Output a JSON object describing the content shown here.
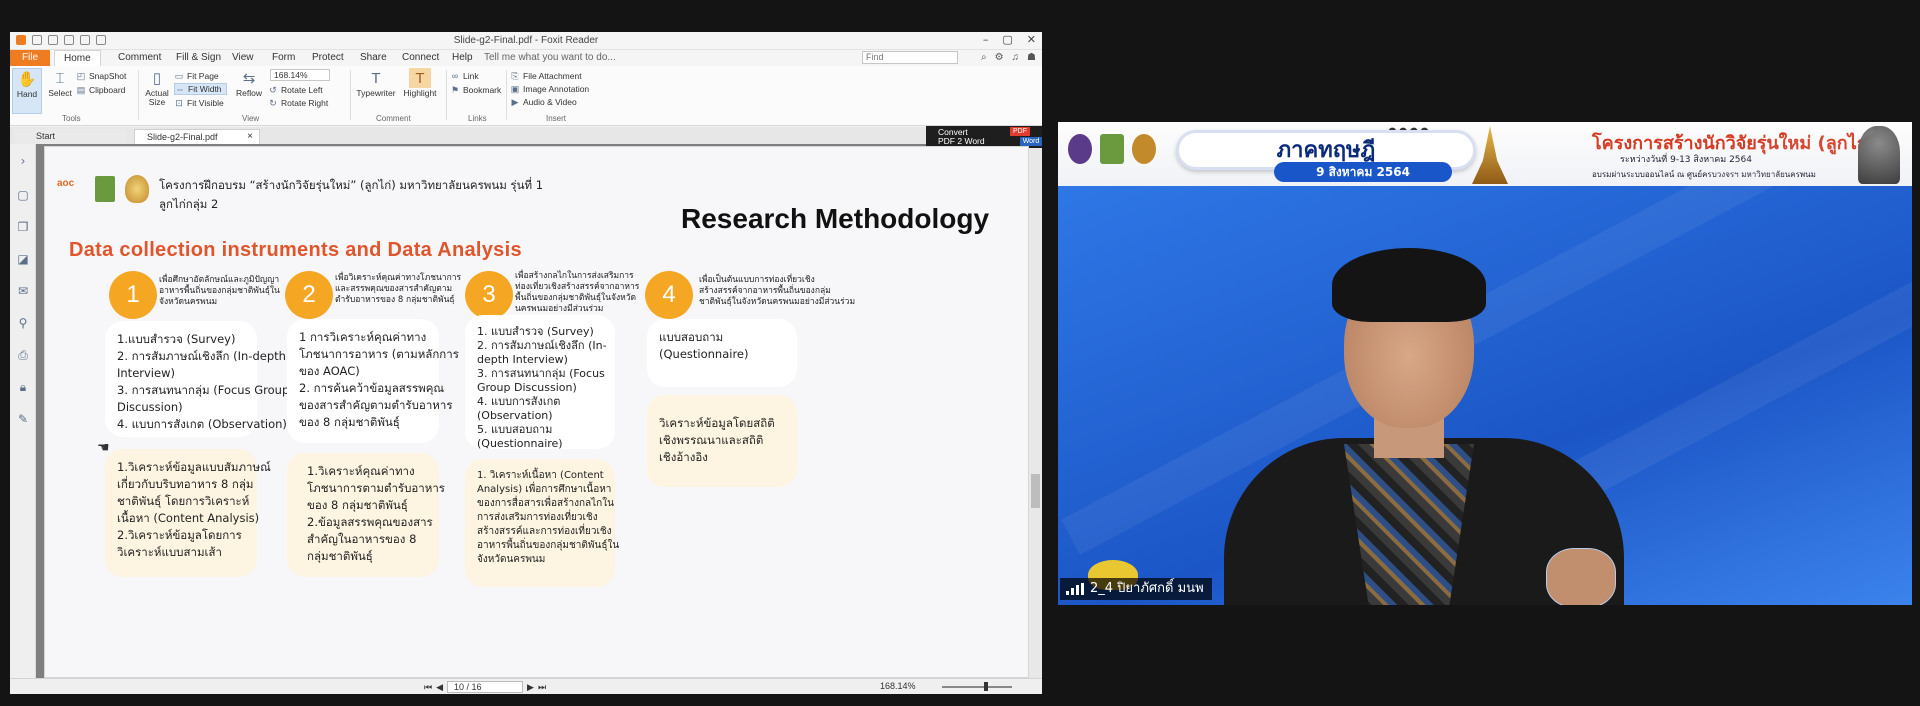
{
  "window": {
    "title": "Slide-g2-Final.pdf - Foxit Reader"
  },
  "menu": {
    "file": "File",
    "tabs": [
      "Home",
      "Comment",
      "Fill & Sign",
      "View",
      "Form",
      "Protect",
      "Share",
      "Connect",
      "Help"
    ],
    "tell_me": "Tell me what you want to do...",
    "find_placeholder": "Find"
  },
  "ribbon": {
    "hand": "Hand",
    "select": "Select",
    "snapshot": "SnapShot",
    "clipboard": "Clipboard",
    "actual_size": "Actual Size",
    "fit_page": "Fit Page",
    "fit_width": "Fit Width",
    "fit_visible": "Fit Visible",
    "reflow": "Reflow",
    "zoom": "168.14%",
    "rotate_left": "Rotate Left",
    "rotate_right": "Rotate Right",
    "typewriter": "Typewriter",
    "highlight": "Highlight",
    "link": "Link",
    "bookmark": "Bookmark",
    "file_attachment": "File Attachment",
    "image_annotation": "Image Annotation",
    "audio_video": "Audio & Video",
    "groups": {
      "tools": "Tools",
      "view": "View",
      "comment": "Comment",
      "links": "Links",
      "insert": "Insert"
    }
  },
  "doc_tabs": {
    "start": "Start",
    "file": "Slide-g2-Final.pdf",
    "close": "×"
  },
  "convert": {
    "line1": "Convert",
    "line2": "PDF 2 Word",
    "pdf": "PDF",
    "word": "Word"
  },
  "status": {
    "page": "10 / 16",
    "zoom": "168.14%"
  },
  "slide": {
    "aoc_logo": "aoc",
    "program": "โครงการฝึกอบรม “สร้างนักวิจัยรุ่นใหม่” (ลูกไก่) มหาวิทยาลัยนครพนม รุ่นที่ 1",
    "group": "ลูกไก่กลุ่ม 2",
    "heading": "Research Methodology",
    "subtitle": "Data collection instruments and Data Analysis",
    "columns": [
      {
        "number": "1",
        "objective": [
          "เพื่อศึกษาอัตลักษณ์และภูมิปัญญา",
          "อาหารพื้นถิ่นของกลุ่มชาติพันธุ์ใน",
          "จังหวัดนครพนม"
        ],
        "methods": [
          "1.แบบสำรวจ (Survey)",
          "2. การสัมภาษณ์เชิงลึก (In-depth",
          "Interview)",
          "3. การสนทนากลุ่ม (Focus Group",
          "Discussion)",
          "4. แบบการสังเกต (Observation)"
        ],
        "analysis": [
          "1.วิเคราะห์ข้อมูลแบบสัมภาษณ์",
          "เกี่ยวกับบริบทอาหาร 8 กลุ่ม",
          "ชาติพันธุ์ โดยการวิเคราะห์",
          "เนื้อหา (Content Analysis)",
          "2.วิเคราะห์ข้อมูลโดยการ",
          "วิเคราะห์แบบสามเส้า"
        ]
      },
      {
        "number": "2",
        "objective": [
          "เพื่อวิเคราะห์คุณค่าทางโภชนาการ",
          "และสรรพคุณของสารสำคัญตาม",
          "ตำรับอาหารของ 8 กลุ่มชาติพันธุ์"
        ],
        "methods": [
          "1 การวิเคราะห์คุณค่าทาง",
          "โภชนาการอาหาร (ตามหลักการ",
          "ของ AOAC)",
          "2. การค้นคว้าข้อมูลสรรพคุณ",
          "ของสารสำคัญตามตำรับอาหาร",
          "ของ 8 กลุ่มชาติพันธุ์"
        ],
        "analysis": [
          "1.วิเคราะห์คุณค่าทาง",
          "โภชนาการตามตำรับอาหาร",
          "ของ 8 กลุ่มชาติพันธุ์",
          "2.ข้อมูลสรรพคุณของสาร",
          "สำคัญในอาหารของ 8",
          "กลุ่มชาติพันธุ์"
        ]
      },
      {
        "number": "3",
        "objective": [
          "เพื่อสร้างกลไกในการส่งเสริมการ",
          "ท่องเที่ยวเชิงสร้างสรรค์จากอาหาร",
          "พื้นถิ่นของกลุ่มชาติพันธุ์ในจังหวัด",
          "นครพนมอย่างมีส่วนร่วม"
        ],
        "methods": [
          "1. แบบสำรวจ (Survey)",
          "2. การสัมภาษณ์เชิงลึก (In-",
          "depth Interview)",
          "3. การสนทนากลุ่ม (Focus",
          "Group Discussion)",
          "4. แบบการสังเกต",
          "(Observation)",
          "5. แบบสอบถาม",
          "(Questionnaire)"
        ],
        "analysis": [
          "1. วิเคราะห์เนื้อหา (Content",
          "Analysis) เพื่อการศึกษาเนื้อหา",
          "ของการสื่อสารเพื่อสร้างกลไกใน",
          "การส่งเสริมการท่องเที่ยวเชิง",
          "สร้างสรรค์และการท่องเที่ยวเชิง",
          "อาหารพื้นถิ่นของกลุ่มชาติพันธุ์ใน",
          "จังหวัดนครพนม"
        ]
      },
      {
        "number": "4",
        "objective": [
          "เพื่อเป็นต้นแบบการท่องเที่ยวเชิง",
          "สร้างสรรค์จากอาหารพื้นถิ่นของกลุ่ม",
          "ชาติพันธุ์ในจังหวัดนครพนมอย่างมีส่วนร่วม"
        ],
        "methods": [
          "แบบสอบถาม",
          "(Questionnaire)"
        ],
        "analysis": [
          "วิเคราะห์ข้อมูลโดยสถิติ",
          "เชิงพรรณนาและสถิติ",
          "เชิงอ้างอิง"
        ]
      }
    ]
  },
  "video": {
    "banner_title": "ภาคทฤษฎี",
    "banner_date": "9 สิงหาคม 2564",
    "project_title": "โครงการสร้างนักวิจัยรุ่นใหม่ (ลูกไก่)",
    "project_line2": "ระหว่างวันที่ 9-13 สิงหาคม 2564",
    "project_line3": "อบรมผ่านระบบออนไลน์ ณ ศูนย์ครบวงจรฯ มหาวิทยาลัยนครพนม",
    "participant_name": "2_4 ปิยาภัศกดิ์ มนพ"
  },
  "colors": {
    "accent_orange": "#f5a623",
    "subtitle_red": "#e0552b",
    "zoom_blue": "#2a6ad8",
    "file_tab": "#f07c22"
  }
}
